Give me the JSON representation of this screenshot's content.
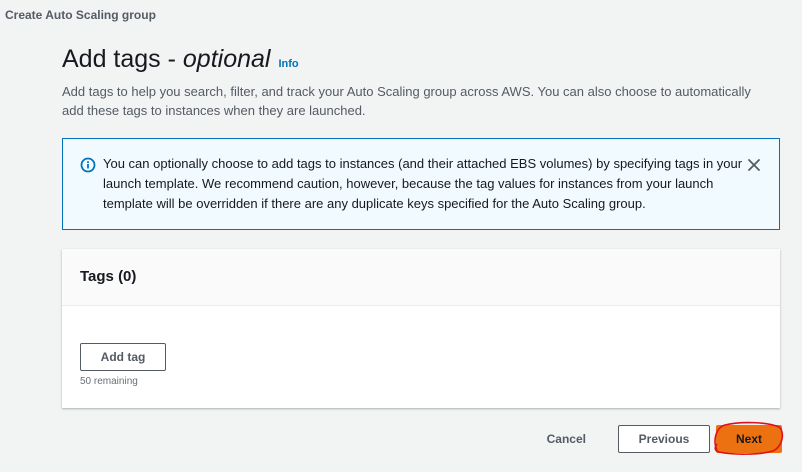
{
  "breadcrumb": "Create Auto Scaling group",
  "header": {
    "title_main": "Add tags - ",
    "title_italic": "optional",
    "info": "Info",
    "description": "Add tags to help you search, filter, and track your Auto Scaling group across AWS. You can also choose to automatically add these tags to instances when they are launched."
  },
  "alert": {
    "icon": "info-circle-icon",
    "text": "You can optionally choose to add tags to instances (and their attached EBS volumes) by specifying tags in your launch template. We recommend caution, however, because the tag values for instances from your launch template will be overridden if there are any duplicate keys specified for the Auto Scaling group.",
    "close_icon": "close-icon"
  },
  "tags_panel": {
    "title": "Tags (0)",
    "add_tag_label": "Add tag",
    "remaining": "50 remaining"
  },
  "footer": {
    "cancel_label": "Cancel",
    "previous_label": "Previous",
    "next_label": "Next"
  },
  "colors": {
    "link": "#0073bb",
    "primary_button": "#ec7211",
    "annotation": "#e0101a"
  }
}
